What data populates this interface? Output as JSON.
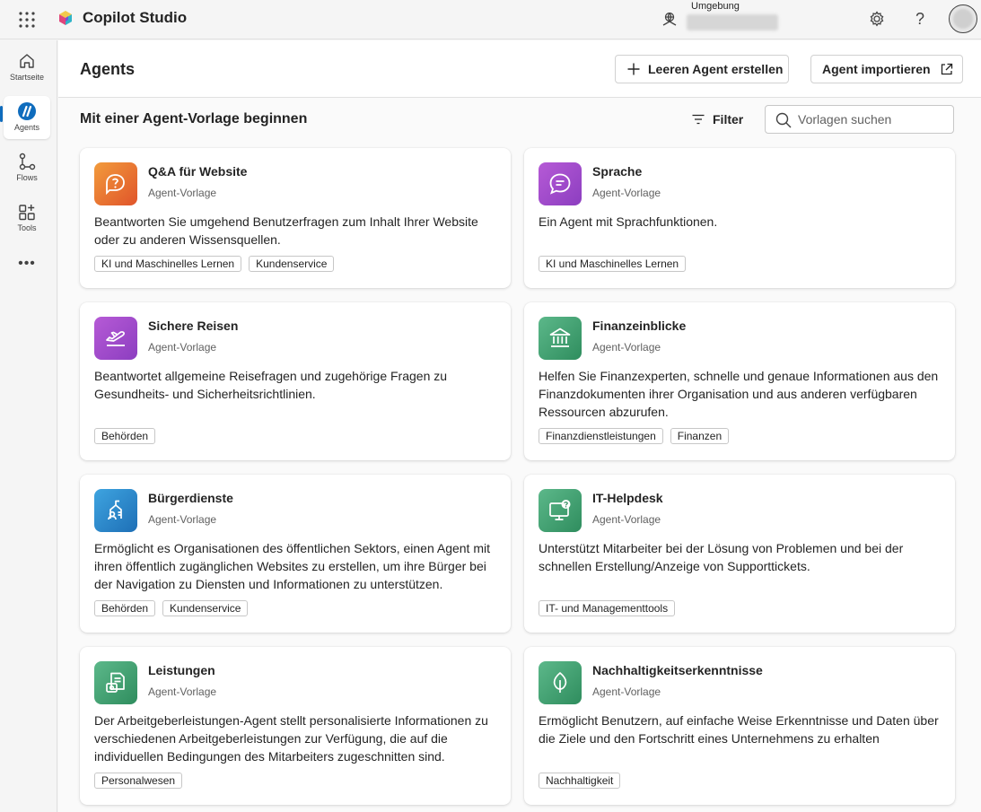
{
  "header": {
    "app_title": "Copilot Studio",
    "environment_label": "Umgebung",
    "help_glyph": "?"
  },
  "rail": {
    "items": [
      {
        "label": "Startseite",
        "icon": "home-icon"
      },
      {
        "label": "Agents",
        "icon": "agents-icon",
        "active": true
      },
      {
        "label": "Flows",
        "icon": "flows-icon"
      },
      {
        "label": "Tools",
        "icon": "tools-icon"
      }
    ],
    "more": "•••"
  },
  "page": {
    "title": "Agents",
    "new_agent_button": "Leeren Agent erstellen",
    "import_button": "Agent importieren",
    "section_title": "Mit einer Agent-Vorlage beginnen",
    "filter_label": "Filter",
    "search_placeholder": "Vorlagen suchen"
  },
  "cards": [
    {
      "title": "Q&A für Website",
      "subtitle": "Agent-Vorlage",
      "description": "Beantworten Sie umgehend Benutzerfragen zum Inhalt Ihrer Website oder zu anderen Wissensquellen.",
      "tags": [
        "KI und Maschinelles Lernen",
        "Kundenservice"
      ],
      "icon": "qna-chat-icon",
      "color": "#ea7a34"
    },
    {
      "title": "Sprache",
      "subtitle": "Agent-Vorlage",
      "description": "Ein Agent mit Sprachfunktionen.",
      "tags": [
        "KI und Maschinelles Lernen"
      ],
      "icon": "speech-bubble-icon",
      "color": "#a24ccd"
    },
    {
      "title": "Sichere Reisen",
      "subtitle": "Agent-Vorlage",
      "description": "Beantwortet allgemeine Reisefragen und zugehörige Fragen zu Gesundheits- und Sicherheitsrichtlinien.",
      "tags": [
        "Behörden"
      ],
      "icon": "airplane-icon",
      "color": "#a24ccd"
    },
    {
      "title": "Finanzeinblicke",
      "subtitle": "Agent-Vorlage",
      "description": "Helfen Sie Finanzexperten, schnelle und genaue Informationen aus den Finanzdokumenten ihrer Organisation und aus anderen verfügbaren Ressourcen abzurufen.",
      "tags": [
        "Finanzdienstleistungen",
        "Finanzen"
      ],
      "icon": "bank-icon",
      "color": "#3c9e6f"
    },
    {
      "title": "Bürgerdienste",
      "subtitle": "Agent-Vorlage",
      "description": "Ermöglicht es Organisationen des öffentlichen Sektors, einen Agent mit ihren öffentlich zugänglichen Websites zu erstellen, um ihre Bürger bei der Navigation zu Diensten und Informationen zu unterstützen.",
      "tags": [
        "Behörden",
        "Kundenservice"
      ],
      "icon": "citizen-services-icon",
      "color": "#2d8ccd"
    },
    {
      "title": "IT-Helpdesk",
      "subtitle": "Agent-Vorlage",
      "description": "Unterstützt Mitarbeiter bei der Lösung von Problemen und bei der schnellen Erstellung/Anzeige von Supporttickets.",
      "tags": [
        "IT- und Managementtools"
      ],
      "icon": "monitor-help-icon",
      "color": "#3c9e6f"
    },
    {
      "title": "Leistungen",
      "subtitle": "Agent-Vorlage",
      "description": "Der Arbeitgeberleistungen-Agent stellt personalisierte Informationen zu verschiedenen Arbeitgeberleistungen zur Verfügung, die auf die individuellen Bedingungen des Mitarbeiters zugeschnitten sind.",
      "tags": [
        "Personalwesen"
      ],
      "icon": "benefits-document-icon",
      "color": "#3c9e6f"
    },
    {
      "title": "Nachhaltigkeitserkenntnisse",
      "subtitle": "Agent-Vorlage",
      "description": "Ermöglicht Benutzern, auf einfache Weise Erkenntnisse und Daten über die Ziele und den Fortschritt eines Unternehmens zu erhalten",
      "tags": [
        "Nachhaltigkeit"
      ],
      "icon": "leaf-icon",
      "color": "#3c9e6f"
    }
  ]
}
